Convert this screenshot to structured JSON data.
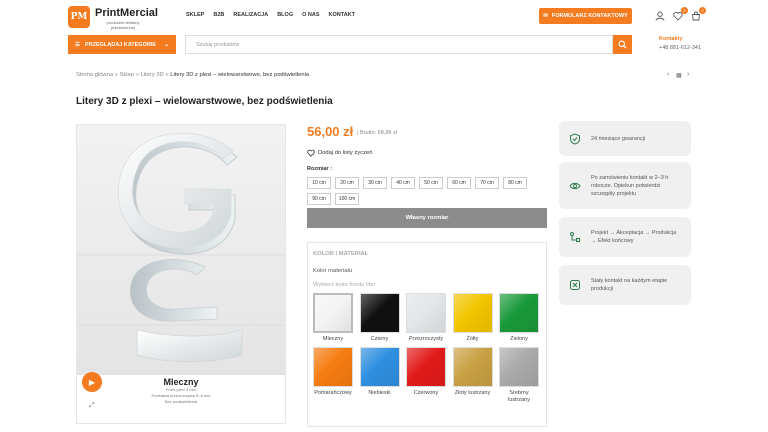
{
  "header": {
    "logo_mark": "PM",
    "logo_name": "PrintMercial",
    "logo_tagline": "producent reklamy przestrzennej",
    "nav": [
      "SKLEP",
      "B2B",
      "REALIZACJA",
      "BLOG",
      "O NAS",
      "KONTAKT"
    ],
    "contact_button": "FORMULARZ KONTAKTOWY",
    "wishlist_count": "0",
    "cart_count": "0",
    "category_button": "PRZEGLĄDAJ KATEGORIE",
    "search_placeholder": "Szukaj produktów",
    "contact_label": "Kontakty",
    "phone": "+48 881-612-341"
  },
  "breadcrumb": {
    "items": [
      "Strona główna",
      "Sklep",
      "Litery 3D"
    ],
    "current": "Litery 3D z plexi – wielowarstwowe, bez podświetlenia",
    "separator": "»"
  },
  "product": {
    "title": "Litery 3D z plexi – wielowarstwowe, bez podświetlenia",
    "price": "56,00 zł",
    "brutto": "| Brutto: 68,88 zł",
    "wishlist_label": "Dodaj do listy życzeń",
    "size_label": "Rozmiar :",
    "sizes": [
      "10 cm",
      "20 cm",
      "30 cm",
      "40 cm",
      "50 cm",
      "60 cm",
      "70 cm",
      "80 cm",
      "90 cm",
      "100 cm"
    ],
    "own_size_button": "Własny rozmiar"
  },
  "gallery": {
    "card_name": "Mleczny",
    "card_lines": [
      "Front plexi 3 mm",
      "Podstawa przezroczysta 5–8 mm",
      "Bez podświetlenia"
    ]
  },
  "material_panel": {
    "heading": "KOLOR I MATERIAŁ",
    "color_label": "Kolor materiału",
    "color_sub": "Wybierz kolor frontu liter",
    "swatches": [
      {
        "name": "Mleczny",
        "color": "#f4f4f4",
        "selected": true
      },
      {
        "name": "Czarny",
        "color": "#111111",
        "selected": false
      },
      {
        "name": "Przezroczysty",
        "color": "#e2e6e8",
        "selected": false
      },
      {
        "name": "Żółty",
        "color": "#f2c500",
        "selected": false
      },
      {
        "name": "Zielony",
        "color": "#1a9a3a",
        "selected": false
      },
      {
        "name": "Pomarańczowy",
        "color": "#f57c10",
        "selected": false
      },
      {
        "name": "Niebieski",
        "color": "#2f8fe0",
        "selected": false
      },
      {
        "name": "Czerwony",
        "color": "#e21b1b",
        "selected": false
      },
      {
        "name": "Złoty lustrzany",
        "color": "#c9a042",
        "selected": false
      },
      {
        "name": "Srebrny lustrzany",
        "color": "#a9a9a9",
        "selected": false
      }
    ]
  },
  "info_cards": [
    {
      "icon": "shield-check-icon",
      "text": "24 miesiące gwarancji"
    },
    {
      "icon": "eye-icon",
      "text": "Po zamówieniu kontakt w 2–3 h robocze. Opiekun potwierdzi szczegóły projektu"
    },
    {
      "icon": "workflow-icon",
      "text": "Projekt → Akceptacja → Produkcja → Efekt końcowy"
    },
    {
      "icon": "support-icon",
      "text": "Stały kontakt na każdym etapie produkcji"
    }
  ]
}
